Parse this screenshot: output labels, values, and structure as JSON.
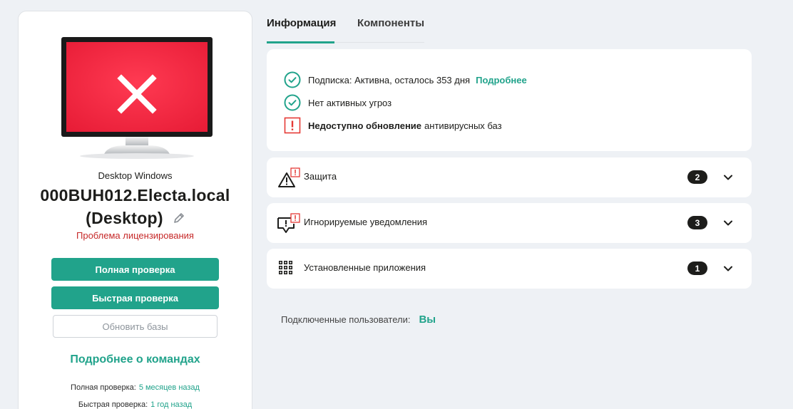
{
  "device": {
    "type": "Desktop Windows",
    "name": "000BUH012.Electa.local (Desktop)",
    "problem": "Проблема лицензирования",
    "status_color": "#f1273f"
  },
  "actions": {
    "full_scan": "Полная проверка",
    "quick_scan": "Быстрая проверка",
    "update_bases": "Обновить базы",
    "commands_link": "Подробнее о командах"
  },
  "scans": {
    "full_label": "Полная проверка:",
    "full_value": "5 месяцев назад",
    "quick_label": "Быстрая проверка:",
    "quick_value": "1 год назад"
  },
  "tabs": {
    "info": "Информация",
    "components": "Компоненты"
  },
  "status": {
    "subscription": "Подписка: Активна, осталось 353 дня",
    "subscription_link": "Подробнее",
    "threats": "Нет активных угроз",
    "update_bold": "Недоступно обновление",
    "update_rest": "антивирусных баз"
  },
  "sections": [
    {
      "label": "Защита",
      "count": "2",
      "icon": "warning-icon"
    },
    {
      "label": "Игнорируемые уведомления",
      "count": "3",
      "icon": "ignored-notifications-icon"
    },
    {
      "label": "Установленные приложения",
      "count": "1",
      "icon": "apps-grid-icon"
    }
  ],
  "users": {
    "label": "Подключенные пользователи:",
    "value": "Вы"
  },
  "colors": {
    "accent": "#21a38b",
    "error": "#c62828",
    "alert": "#e53935"
  }
}
